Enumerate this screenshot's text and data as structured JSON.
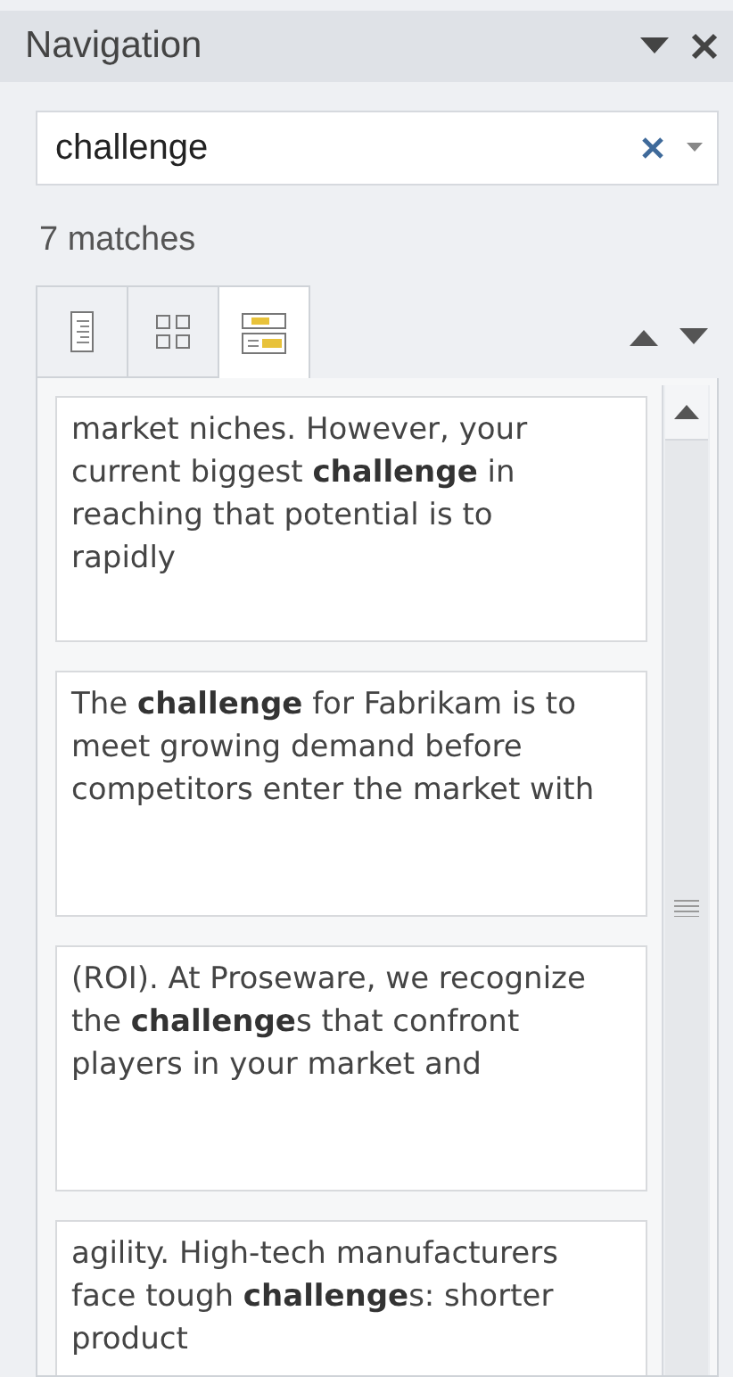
{
  "panel": {
    "title": "Navigation"
  },
  "search": {
    "value": "challenge"
  },
  "match_count": "7 matches",
  "tabs": [
    {
      "kind": "headings",
      "selected": false
    },
    {
      "kind": "pages",
      "selected": false
    },
    {
      "kind": "results",
      "selected": true
    }
  ],
  "results": [
    "market niches. However, your current biggest **challenge** in reaching that potential is to rapidly",
    "The **challenge** for Fabrikam is to meet growing demand before competitors enter the market with",
    "(ROI). At Proseware, we recognize the **challenge**s that confront players in your market and",
    "agility. High-tech manufacturers face tough **challenge**s: shorter product"
  ]
}
